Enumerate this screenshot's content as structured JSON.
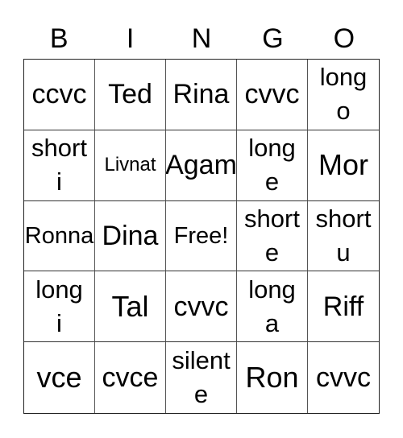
{
  "header": [
    "B",
    "I",
    "N",
    "G",
    "O"
  ],
  "cells": [
    [
      "ccvc",
      "Ted",
      "Rina",
      "cvvc",
      "long\no"
    ],
    [
      "short\ni",
      "Livnat",
      "Agam",
      "long\ne",
      "Mor"
    ],
    [
      "Ronna",
      "Dina",
      "Free!",
      "short\ne",
      "short\nu"
    ],
    [
      "long\ni",
      "Tal",
      "cvvc",
      "long\na",
      "Riff"
    ],
    [
      "vce",
      "cvce",
      "silent\ne",
      "Ron",
      "cvvc"
    ]
  ]
}
